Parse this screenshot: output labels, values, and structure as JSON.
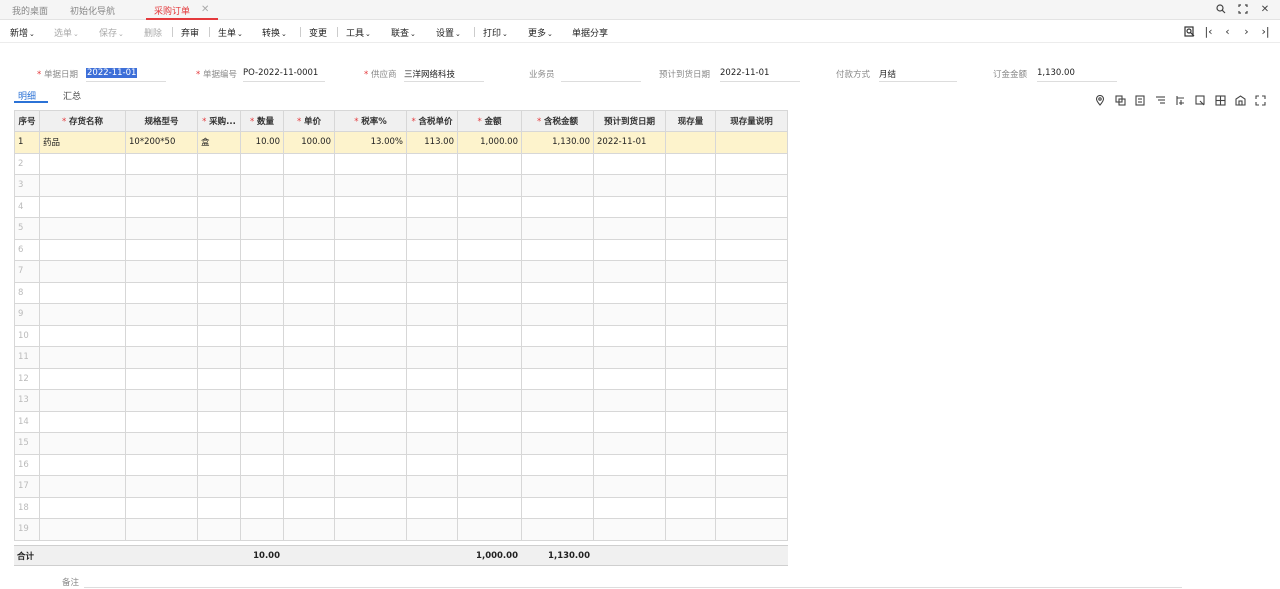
{
  "tabs": [
    "我的桌面",
    "初始化导航",
    "采购订单"
  ],
  "toolbar": {
    "new": "新增",
    "select": "选单",
    "save": "保存",
    "delete": "删除",
    "abandon": "弃审",
    "generate": "生单",
    "convert": "转换",
    "change": "变更",
    "tools": "工具",
    "query": "联查",
    "settings": "设置",
    "print": "打印",
    "more": "更多",
    "share": "单据分享"
  },
  "form": {
    "date_label": "单据日期",
    "date_value": "2022-11-01",
    "code_label": "单据编号",
    "code_value": "PO-2022-11-0001",
    "supplier_label": "供应商",
    "supplier_value": "三洋网络科技",
    "staff_label": "业务员",
    "staff_value": "",
    "arrival_label": "预计到货日期",
    "arrival_value": "2022-11-01",
    "payment_label": "付款方式",
    "payment_value": "月结",
    "amount_label": "订金金额",
    "amount_value": "1,130.00"
  },
  "subtabs": [
    "明细",
    "汇总"
  ],
  "grid": {
    "headers": [
      "序号",
      "存货名称",
      "规格型号",
      "采购...",
      "数量",
      "单价",
      "税率%",
      "含税单价",
      "金额",
      "含税金额",
      "预计到货日期",
      "现存量",
      "现存量说明"
    ],
    "rows": [
      [
        "1",
        "药品",
        "10*200*50",
        "盒",
        "10.00",
        "100.00",
        "13.00%",
        "113.00",
        "1,000.00",
        "1,130.00",
        "2022-11-01",
        "",
        ""
      ],
      [
        "2"
      ],
      [
        "3"
      ],
      [
        "4"
      ],
      [
        "5"
      ],
      [
        "6"
      ],
      [
        "7"
      ],
      [
        "8"
      ],
      [
        "9"
      ],
      [
        "10"
      ],
      [
        "11"
      ],
      [
        "12"
      ],
      [
        "13"
      ],
      [
        "14"
      ],
      [
        "15"
      ],
      [
        "16"
      ],
      [
        "17"
      ],
      [
        "18"
      ],
      [
        "19"
      ]
    ]
  },
  "totals": {
    "label": "合计",
    "qty": "10.00",
    "amount": "1,000.00",
    "tax_amount": "1,130.00"
  },
  "remark_label": "备注"
}
